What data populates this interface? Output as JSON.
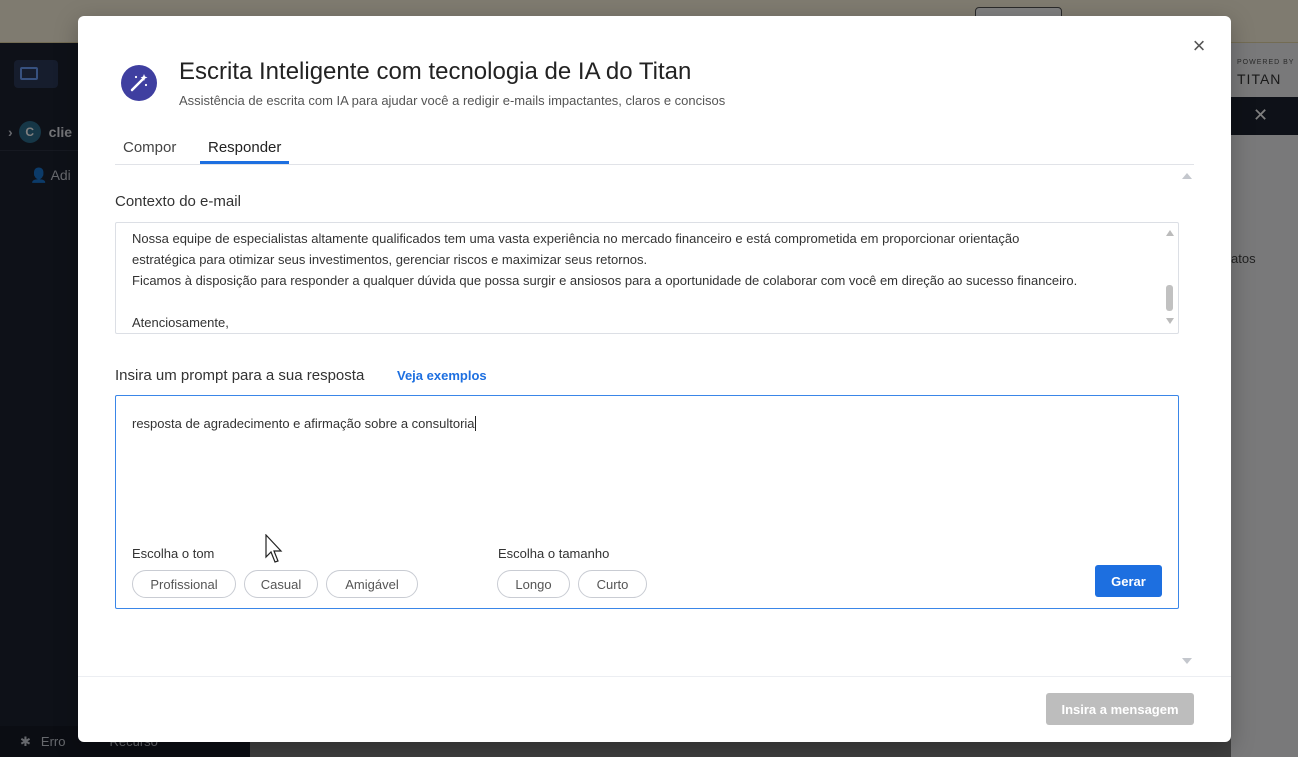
{
  "background": {
    "account_initial": "C",
    "account_name": "clie",
    "add_item": "Adi",
    "bottom_left": "Erro",
    "bottom_mid": "Recurso",
    "right_powered": "POWERED BY",
    "right_brand": "TITAN",
    "right_close": "✕",
    "right_partial": "atos"
  },
  "modal": {
    "title": "Escrita Inteligente com tecnologia de IA do Titan",
    "subtitle": "Assistência de escrita com IA para ajudar você a redigir e-mails impactantes, claros e concisos",
    "close_icon": "×",
    "tabs": [
      {
        "label": "Compor",
        "active": false
      },
      {
        "label": "Responder",
        "active": true
      }
    ],
    "context": {
      "label": "Contexto do e-mail",
      "text": "Nossa equipe de especialistas altamente qualificados tem uma vasta experiência no mercado financeiro e está comprometida em proporcionar orientação\nestratégica para otimizar seus investimentos, gerenciar riscos e maximizar seus retornos.\nFicamos à disposição para responder a qualquer dúvida que possa surgir e ansiosos para a oportunidade de colaborar com você em direção ao sucesso financeiro.\n\nAtenciosamente,"
    },
    "prompt": {
      "label": "Insira um prompt para a sua resposta",
      "examples_link": "Veja exemplos",
      "value": "resposta de agradecimento e afirmação sobre a consultoria"
    },
    "tone": {
      "label": "Escolha o tom",
      "options": [
        "Profissional",
        "Casual",
        "Amigável"
      ]
    },
    "size": {
      "label": "Escolha o tamanho",
      "options": [
        "Longo",
        "Curto"
      ]
    },
    "generate_button": "Gerar",
    "insert_button": "Insira a mensagem",
    "colors": {
      "accent": "#1d6fe0",
      "icon_bg": "#3f3fa0",
      "disabled": "#bdbdbd"
    }
  }
}
